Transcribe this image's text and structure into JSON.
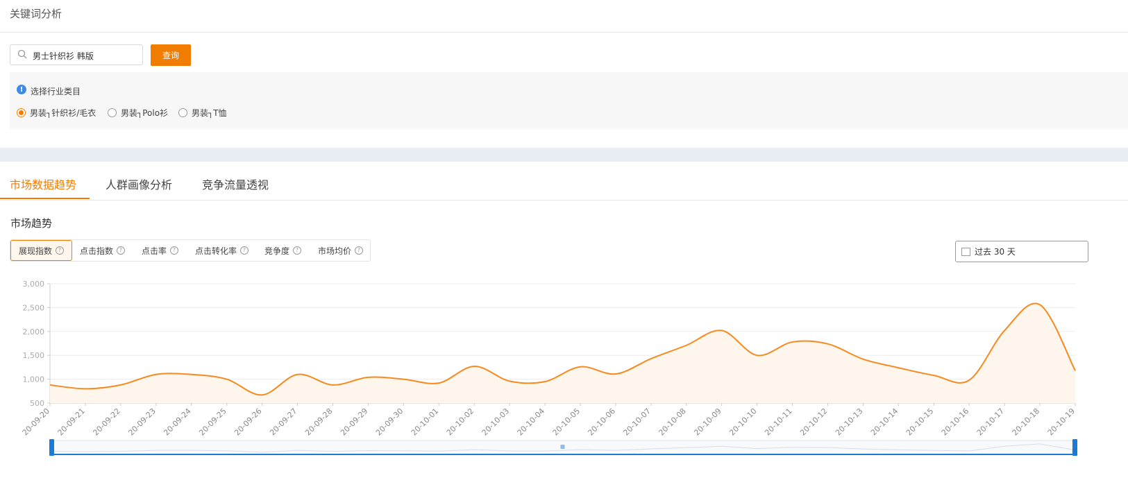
{
  "page": {
    "title": "关键词分析"
  },
  "search": {
    "value": "男士针织衫 韩版",
    "button": "查询"
  },
  "category": {
    "label": "选择行业类目",
    "options": [
      "男装┐针织衫/毛衣",
      "男装┐Polo衫",
      "男装┐T恤"
    ],
    "selected_index": 0
  },
  "tabs": [
    "市场数据趋势",
    "人群画像分析",
    "竞争流量透视"
  ],
  "active_tab": 0,
  "section_title": "市场趋势",
  "metrics": [
    "展现指数",
    "点击指数",
    "点击率",
    "点击转化率",
    "竞争度",
    "市场均价"
  ],
  "active_metric": 0,
  "date_range": "过去 30 天",
  "colors": {
    "accent": "#f07d00",
    "line": "#f7891e",
    "slider": "#1a7bd6",
    "info": "#3f8ce6"
  },
  "chart_data": {
    "type": "area",
    "x": [
      "20-09-20",
      "20-09-21",
      "20-09-22",
      "20-09-23",
      "20-09-24",
      "20-09-25",
      "20-09-26",
      "20-09-27",
      "20-09-28",
      "20-09-29",
      "20-09-30",
      "20-10-01",
      "20-10-02",
      "20-10-03",
      "20-10-04",
      "20-10-05",
      "20-10-06",
      "20-10-07",
      "20-10-08",
      "20-10-09",
      "20-10-10",
      "20-10-11",
      "20-10-12",
      "20-10-13",
      "20-10-14",
      "20-10-15",
      "20-10-16",
      "20-10-17",
      "20-10-18",
      "20-10-19"
    ],
    "y": [
      880,
      800,
      880,
      1100,
      1100,
      1000,
      670,
      1100,
      880,
      1040,
      1000,
      920,
      1270,
      960,
      950,
      1260,
      1110,
      1430,
      1710,
      2020,
      1500,
      1780,
      1740,
      1420,
      1240,
      1080,
      980,
      2020,
      2560,
      1180
    ],
    "yticks": [
      "3,000",
      "2,500",
      "2,000",
      "1,500",
      "1,000",
      "500"
    ],
    "ylim": [
      500,
      3000
    ],
    "grid": true
  }
}
